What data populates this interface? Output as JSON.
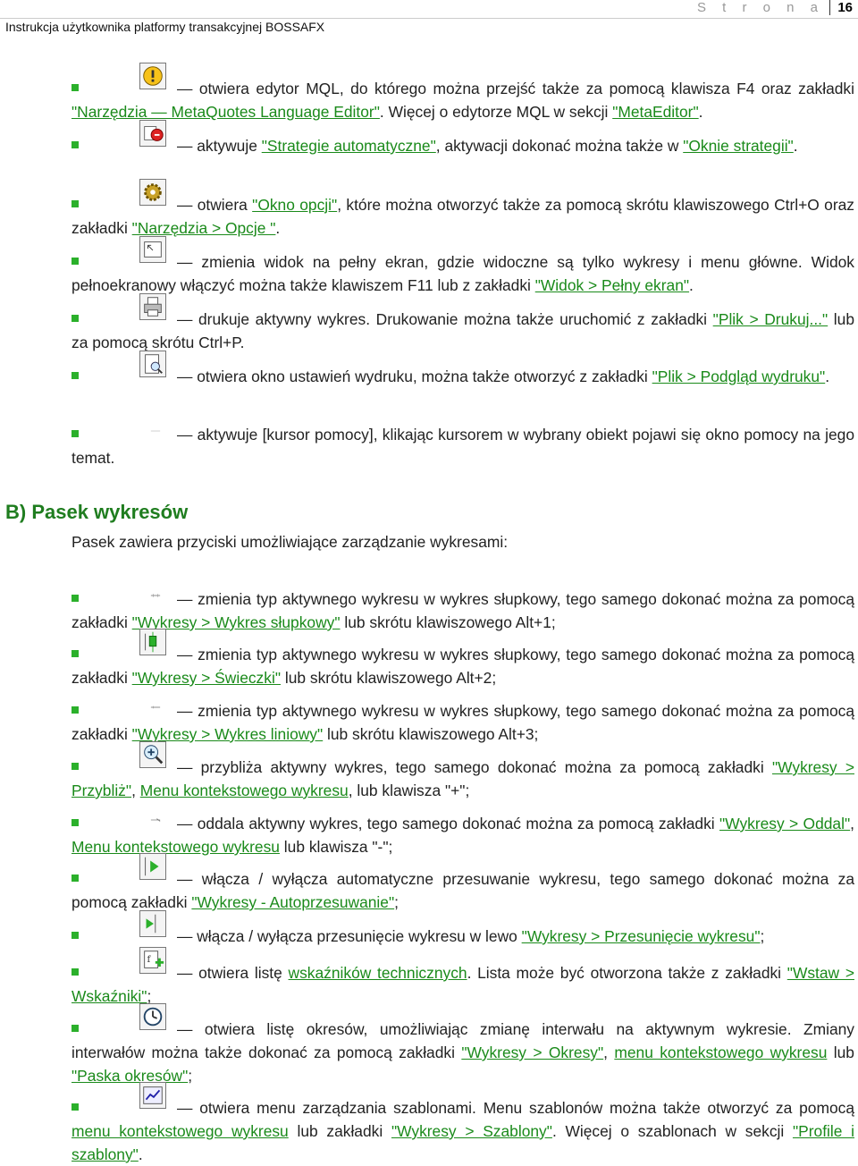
{
  "header": {
    "title": "Instrukcja użytkownika platformy transakcyjnej BOSSAFX",
    "page_label": "S t r o n a",
    "page_number": "16"
  },
  "items_top": [
    {
      "icon": "warning-icon",
      "parts": [
        {
          "t": "— otwiera edytor MQL, do którego można przejść także za pomocą klawisza F4 oraz zakładki "
        },
        {
          "l": "\"Narzędzia — MetaQuotes Language Editor\""
        },
        {
          "t": ". Więcej o edytorze MQL w sekcji "
        },
        {
          "l": "\"MetaEditor\""
        },
        {
          "t": "."
        }
      ]
    },
    {
      "icon": "auto-strategy-icon",
      "parts": [
        {
          "t": "— aktywuje "
        },
        {
          "l": "\"Strategie automatyczne\""
        },
        {
          "t": ", aktywacji dokonać można także w "
        },
        {
          "l": "\"Oknie strategii\""
        },
        {
          "t": "."
        }
      ]
    },
    {
      "icon": "options-gear-icon",
      "parts": [
        {
          "t": "— otwiera "
        },
        {
          "l": "\"Okno opcji\""
        },
        {
          "t": ", które można otworzyć także za pomocą skrótu klawiszowego Ctrl+O oraz zakładki "
        },
        {
          "l": "\"Narzędzia > Opcje \""
        },
        {
          "t": "."
        }
      ]
    },
    {
      "icon": "fullscreen-icon",
      "parts": [
        {
          "t": "— zmienia widok na pełny ekran, gdzie widoczne są tylko wykresy i menu główne. Widok pełnoekranowy włączyć można także klawiszem F11 lub z zakładki "
        },
        {
          "l": "\"Widok > Pełny ekran\""
        },
        {
          "t": "."
        }
      ]
    },
    {
      "icon": "print-icon",
      "parts": [
        {
          "t": "— drukuje aktywny wykres. Drukowanie można także uruchomić z zakładki "
        },
        {
          "l": "\"Plik > Drukuj...\""
        },
        {
          "t": " lub za pomocą skrótu Ctrl+P."
        }
      ]
    },
    {
      "icon": "print-preview-icon",
      "parts": [
        {
          "t": "— otwiera okno ustawień wydruku, można także otworzyć z zakładki "
        },
        {
          "l": "\"Plik > Podgląd wydruku\""
        },
        {
          "t": "."
        }
      ]
    },
    {
      "icon": "help-cursor-icon",
      "parts": [
        {
          "t": "— aktywuje [kursor pomocy], klikając kursorem w wybrany obiekt pojawi się okno pomocy na jego temat."
        }
      ]
    }
  ],
  "section": {
    "title": "B)  Pasek wykresów",
    "intro": "Pasek zawiera przyciski umożliwiające zarządzanie wykresami:"
  },
  "items_bottom": [
    {
      "icon": "bar-chart-icon",
      "parts": [
        {
          "t": "— zmienia typ aktywnego wykresu w wykres słupkowy, tego samego dokonać można za pomocą zakładki "
        },
        {
          "l": "\"Wykresy > Wykres słupkowy\""
        },
        {
          "t": " lub skrótu klawiszowego Alt+1;"
        }
      ]
    },
    {
      "icon": "candlestick-icon",
      "parts": [
        {
          "t": "— zmienia typ aktywnego wykresu w wykres słupkowy, tego samego dokonać można za pomocą zakładki "
        },
        {
          "l": "\"Wykresy > Świeczki\""
        },
        {
          "t": " lub skrótu klawiszowego Alt+2;"
        }
      ]
    },
    {
      "icon": "line-chart-icon",
      "parts": [
        {
          "t": "— zmienia typ aktywnego wykresu w wykres słupkowy, tego samego dokonać można za pomocą zakładki "
        },
        {
          "l": "\"Wykresy > Wykres liniowy\""
        },
        {
          "t": " lub skrótu klawiszowego Alt+3;"
        }
      ]
    },
    {
      "icon": "zoom-in-icon",
      "parts": [
        {
          "t": "— przybliża aktywny wykres, tego samego dokonać można za pomocą zakładki "
        },
        {
          "l": "\"Wykresy > Przybliż\""
        },
        {
          "t": ", "
        },
        {
          "l": "Menu kontekstowego wykresu"
        },
        {
          "t": ", lub klawisza \"+\";"
        }
      ]
    },
    {
      "icon": "zoom-out-icon",
      "parts": [
        {
          "t": "— oddala aktywny wykres, tego samego dokonać można za pomocą zakładki "
        },
        {
          "l": "\"Wykresy > Oddal\""
        },
        {
          "t": ", "
        },
        {
          "l": "Menu kontekstowego wykresu"
        },
        {
          "t": " lub klawisza \"-\";"
        }
      ]
    },
    {
      "icon": "autoscroll-icon",
      "parts": [
        {
          "t": "— włącza / wyłącza automatyczne przesuwanie wykresu, tego samego dokonać można za pomocą zakładki "
        },
        {
          "l": "\"Wykresy - Autoprzesuwanie\""
        },
        {
          "t": ";"
        }
      ]
    },
    {
      "icon": "chart-shift-icon",
      "parts": [
        {
          "t": "— włącza / wyłącza przesunięcie wykresu w lewo "
        },
        {
          "l": "\"Wykresy > Przesunięcie wykresu\""
        },
        {
          "t": ";"
        }
      ]
    },
    {
      "icon": "add-indicator-icon",
      "parts": [
        {
          "t": "— otwiera listę "
        },
        {
          "l": "wskaźników technicznych"
        },
        {
          "t": ". Lista może być otworzona także z zakładki "
        },
        {
          "l": "\"Wstaw > Wskaźniki\""
        },
        {
          "t": ";"
        }
      ]
    },
    {
      "icon": "periods-clock-icon",
      "parts": [
        {
          "t": "— otwiera listę okresów, umożliwiając zmianę interwału na aktywnym wykresie. Zmiany interwałów można także dokonać za pomocą zakładki "
        },
        {
          "l": "\"Wykresy > Okresy\""
        },
        {
          "t": ", "
        },
        {
          "l": "menu kontekstowego wykresu"
        },
        {
          "t": " lub "
        },
        {
          "l": "\"Paska okresów\""
        },
        {
          "t": ";"
        }
      ]
    },
    {
      "icon": "templates-icon",
      "parts": [
        {
          "t": "— otwiera menu zarządzania szablonami. Menu szablonów można także otworzyć za pomocą "
        },
        {
          "l": "menu kontekstowego wykresu"
        },
        {
          "t": " lub zakładki "
        },
        {
          "l": "\"Wykresy > Szablony\""
        },
        {
          "t": ". Więcej o szablonach w sekcji "
        },
        {
          "l": "\"Profile i szablony\""
        },
        {
          "t": "."
        }
      ]
    }
  ],
  "colors": {
    "bullet": "#2bb02b",
    "link": "#1a8a1a",
    "heading": "#1f7d1f"
  }
}
